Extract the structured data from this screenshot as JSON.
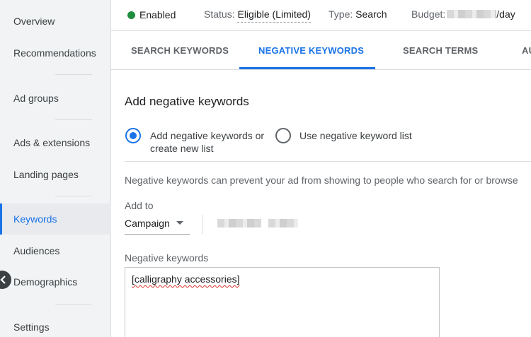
{
  "sidebar": {
    "items": [
      {
        "label": "Overview",
        "active": false
      },
      {
        "label": "Recommendations",
        "active": false
      },
      {
        "label": "Ad groups",
        "active": false
      },
      {
        "label": "Ads & extensions",
        "active": false
      },
      {
        "label": "Landing pages",
        "active": false
      },
      {
        "label": "Keywords",
        "active": true
      },
      {
        "label": "Audiences",
        "active": false
      },
      {
        "label": "Demographics",
        "active": false
      },
      {
        "label": "Settings",
        "active": false
      }
    ],
    "collapse_icon": "chevron-left-icon"
  },
  "topbar": {
    "enabled_label": "Enabled",
    "status_prefix": "Status:",
    "status_value": "Eligible (Limited)",
    "type_prefix": "Type:",
    "type_value": "Search",
    "budget_prefix": "Budget:",
    "budget_suffix": "/day",
    "enabled_color": "#1e8e3e"
  },
  "tabs": [
    {
      "label": "SEARCH KEYWORDS",
      "active": false
    },
    {
      "label": "NEGATIVE KEYWORDS",
      "active": true
    },
    {
      "label": "SEARCH TERMS",
      "active": false
    },
    {
      "label": "AU",
      "active": false
    }
  ],
  "main": {
    "title": "Add negative keywords",
    "radio_options": [
      {
        "label_line1": "Add negative keywords or",
        "label_line2": "create new list",
        "checked": true
      },
      {
        "label_line1": "Use negative keyword list",
        "label_line2": "",
        "checked": false
      }
    ],
    "description": "Negative keywords can prevent your ad from showing to people who search for or browse",
    "add_to_label": "Add to",
    "add_to_value": "Campaign",
    "negative_keywords_label": "Negative keywords",
    "negative_keywords_value": "[calligraphy accessories]"
  },
  "colors": {
    "accent": "#1a73e8",
    "sidebar_bg": "#f1f3f4",
    "spellcheck": "#d93025"
  }
}
